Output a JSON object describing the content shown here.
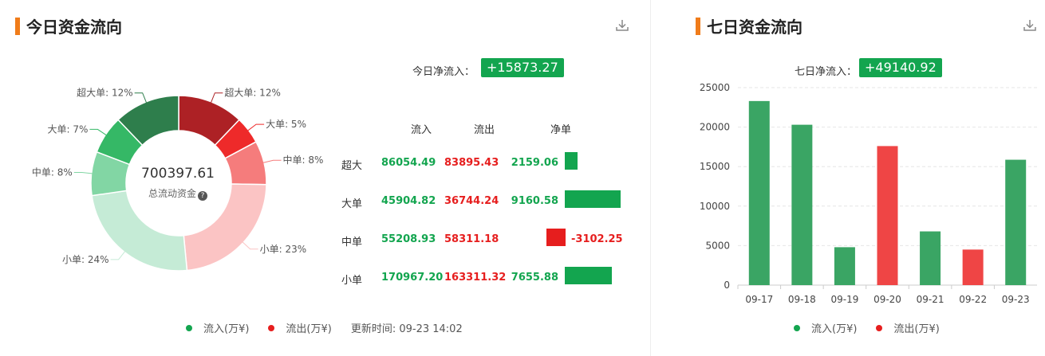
{
  "left": {
    "title": "今日资金流向",
    "net_label": "今日净流入：",
    "net_value": "+15873.27",
    "donut": {
      "center_value": "700397.61",
      "center_label": "总流动资金",
      "slices": [
        {
          "label": "超大单: 12%",
          "pct": 12,
          "color": "#ad2125"
        },
        {
          "label": "大单: 5%",
          "pct": 5,
          "color": "#ee2a2a"
        },
        {
          "label": "中单: 8%",
          "pct": 8,
          "color": "#f57c7c"
        },
        {
          "label": "小单: 23%",
          "pct": 23,
          "color": "#fbc4c4"
        },
        {
          "label": "小单: 24%",
          "pct": 24,
          "color": "#c5ebd6"
        },
        {
          "label": "中单: 8%",
          "pct": 8,
          "color": "#82d6a4"
        },
        {
          "label": "大单: 7%",
          "pct": 7,
          "color": "#35b866"
        },
        {
          "label": "超大单: 12%",
          "pct": 12,
          "color": "#2e7e4c"
        }
      ]
    },
    "table": {
      "headers": [
        "流入",
        "流出",
        "净单"
      ],
      "rows": [
        {
          "label": "超大",
          "in": "86054.49",
          "out": "83895.43",
          "net": "2159.06",
          "net_value": 2159.06
        },
        {
          "label": "大单",
          "in": "45904.82",
          "out": "36744.24",
          "net": "9160.58",
          "net_value": 9160.58
        },
        {
          "label": "中单",
          "in": "55208.93",
          "out": "58311.18",
          "net": "-3102.25",
          "net_value": -3102.25
        },
        {
          "label": "小单",
          "in": "170967.20",
          "out": "163311.32",
          "net": "7655.88",
          "net_value": 7655.88
        }
      ]
    },
    "legend": {
      "in_label": "流入(万¥)",
      "out_label": "流出(万¥)",
      "update_time": "更新时间: 09-23 14:02"
    }
  },
  "right": {
    "title": "七日资金流向",
    "net_label": "七日净流入：",
    "net_value": "+49140.92",
    "legend": {
      "in_label": "流入(万¥)",
      "out_label": "流出(万¥)"
    }
  },
  "colors": {
    "inflow": "#3aa564",
    "outflow": "#ef4545",
    "badge": "#13a54f",
    "accent": "#f07c1a"
  },
  "chart_data": [
    {
      "type": "pie",
      "title": "今日资金流向",
      "categories": [
        "超大单",
        "大单",
        "中单",
        "小单",
        "小单",
        "中单",
        "大单",
        "超大单"
      ],
      "values": [
        12,
        5,
        8,
        23,
        24,
        8,
        7,
        12
      ],
      "series": [
        {
          "name": "流出(万¥)",
          "categories": [
            "超大单",
            "大单",
            "中单",
            "小单"
          ],
          "values": [
            12,
            5,
            8,
            23
          ]
        },
        {
          "name": "流入(万¥)",
          "categories": [
            "小单",
            "中单",
            "大单",
            "超大单"
          ],
          "values": [
            24,
            8,
            7,
            12
          ]
        }
      ],
      "center_text": "700397.61"
    },
    {
      "type": "bar",
      "title": "七日资金流向",
      "categories": [
        "09-17",
        "09-18",
        "09-19",
        "09-20",
        "09-21",
        "09-22",
        "09-23"
      ],
      "values": [
        23300,
        20300,
        4800,
        17600,
        6800,
        4500,
        15870
      ],
      "bar_colors": [
        "#3aa564",
        "#3aa564",
        "#3aa564",
        "#ef4545",
        "#3aa564",
        "#ef4545",
        "#3aa564"
      ],
      "yticks": [
        0,
        5000,
        10000,
        15000,
        20000,
        25000
      ],
      "ylim": [
        0,
        25000
      ],
      "grid": true,
      "legend": [
        "流入(万¥)",
        "流出(万¥)"
      ]
    }
  ]
}
